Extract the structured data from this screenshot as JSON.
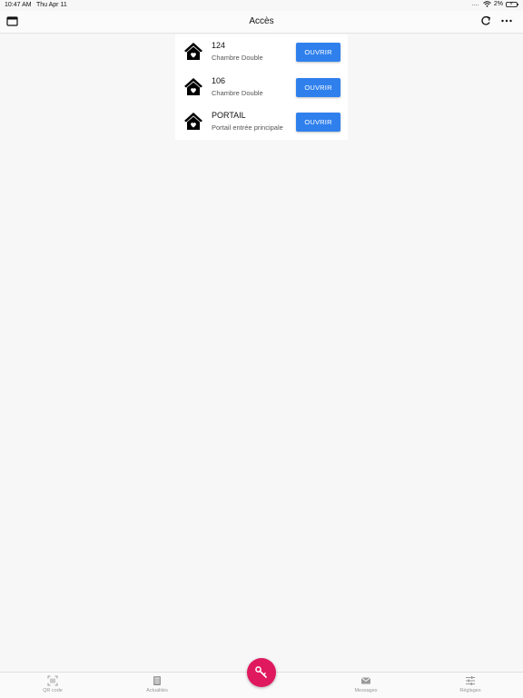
{
  "status_bar": {
    "time": "10:47 AM",
    "date": "Thu Apr 11",
    "battery": "2%"
  },
  "nav": {
    "title": "Accès"
  },
  "access_items": [
    {
      "title": "124",
      "subtitle": "Chambre Double",
      "button": "OUVRIR"
    },
    {
      "title": "106",
      "subtitle": "Chambre Double",
      "button": "OUVRIR"
    },
    {
      "title": "PORTAIL",
      "subtitle": "Portail entrée principale",
      "button": "OUVRIR"
    }
  ],
  "tabs": [
    {
      "label": "QR code",
      "icon": "qr-code-icon"
    },
    {
      "label": "Actualités",
      "icon": "news-icon"
    },
    {
      "label": "Messages",
      "icon": "envelope-icon"
    },
    {
      "label": "Réglages",
      "icon": "sliders-icon"
    }
  ],
  "fab": {
    "icon": "key-icon",
    "color": "#e0195f"
  },
  "colors": {
    "accent": "#2f80ed",
    "background": "#f7f7f7"
  }
}
